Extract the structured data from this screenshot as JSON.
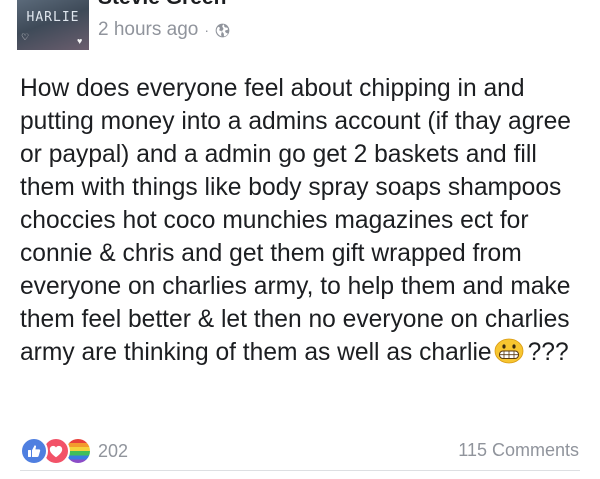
{
  "post": {
    "author": "Stevie Green",
    "avatar_text": "HARLIE",
    "timestamp": "2 hours ago",
    "separator": "·",
    "privacy_icon": "globe-icon",
    "text_before_emoji": "How does everyone feel about chipping in and putting money into a admins account (if thay agree or paypal) and a admin go get 2 baskets and fill them with things like body spray soaps shampoos choccies hot coco munchies magazines ect for connie & chris and get them gift wrapped from everyone on charlies army, to help them and make them feel better & let then no everyone on charlies army are thinking of them as well as charlie",
    "emoji": "grinning-face-icon",
    "text_after_emoji": "???"
  },
  "footer": {
    "reaction_icons": [
      "like-icon",
      "love-icon",
      "pride-icon"
    ],
    "reaction_count": "202",
    "comments": "115 Comments"
  },
  "colors": {
    "like": "#4f7fe0",
    "love": "#f25268",
    "meta_text": "#90949c",
    "body_text": "#1c1e21"
  }
}
